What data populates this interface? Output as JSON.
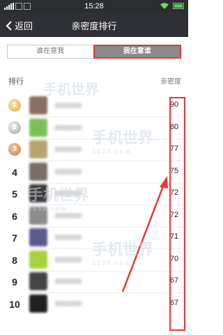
{
  "status_bar": {
    "time": "15:28"
  },
  "nav": {
    "back_label": "返回",
    "title": "亲密度排行"
  },
  "tabs": [
    {
      "label": "谁在意我",
      "active": false
    },
    {
      "label": "我在意谁",
      "active": true
    }
  ],
  "list_header": {
    "left": "排行",
    "right": "亲密度"
  },
  "rows": [
    {
      "rank": "1",
      "medal": "gold",
      "score": "90",
      "avatar_color": "#8a7060"
    },
    {
      "rank": "2",
      "medal": "silver",
      "score": "80",
      "avatar_color": "#7fbf58"
    },
    {
      "rank": "3",
      "medal": "bronze",
      "score": "77",
      "avatar_color": "#b9a36d"
    },
    {
      "rank": "4",
      "medal": "",
      "score": "75",
      "avatar_color": "#7a6e6a"
    },
    {
      "rank": "5",
      "medal": "",
      "score": "72",
      "avatar_color": "#3b3b3b"
    },
    {
      "rank": "6",
      "medal": "",
      "score": "72",
      "avatar_color": "#8c8c8c"
    },
    {
      "rank": "7",
      "medal": "",
      "score": "71",
      "avatar_color": "#5c5a8c"
    },
    {
      "rank": "8",
      "medal": "",
      "score": "70",
      "avatar_color": "#a6d33a"
    },
    {
      "rank": "9",
      "medal": "",
      "score": "67",
      "avatar_color": "#444444"
    },
    {
      "rank": "10",
      "medal": "",
      "score": "67",
      "avatar_color": "#202020"
    }
  ],
  "watermark": {
    "text": "手机世界",
    "subtext": "3533.com"
  },
  "colors": {
    "highlight": "#e53935",
    "nav_bg": "#2f3035",
    "status_bg": "#2b2d31"
  }
}
